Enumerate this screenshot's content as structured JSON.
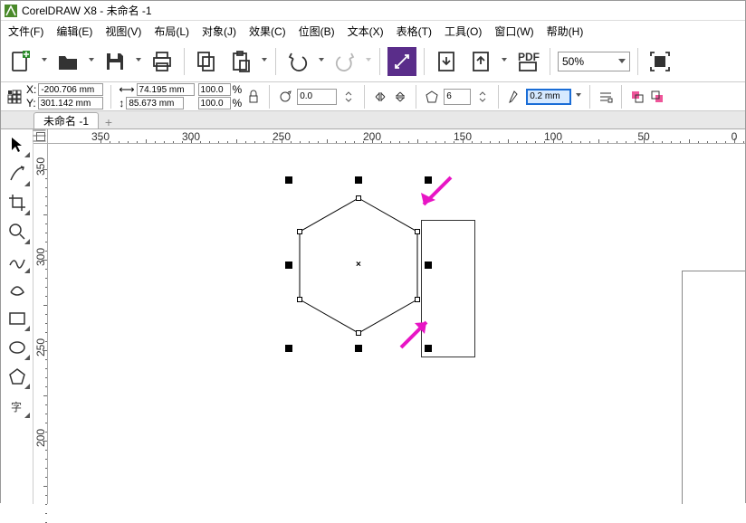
{
  "title": "CorelDRAW X8 - 未命名 -1",
  "menu": [
    "文件(F)",
    "编辑(E)",
    "视图(V)",
    "布局(L)",
    "对象(J)",
    "效果(C)",
    "位图(B)",
    "文本(X)",
    "表格(T)",
    "工具(O)",
    "窗口(W)",
    "帮助(H)"
  ],
  "zoom": "50%",
  "tab_name": "未命名 -1",
  "props": {
    "x": "-200.706 mm",
    "y": "301.142 mm",
    "w": "74.195 mm",
    "h": "85.673 mm",
    "sx": "100.0",
    "sy": "100.0",
    "pct": "%",
    "rot": "0.0",
    "sides": "6",
    "outline": "0.2 mm"
  },
  "ruler_h": [
    {
      "v": "350",
      "p": 58
    },
    {
      "v": "300",
      "p": 158
    },
    {
      "v": "250",
      "p": 258
    },
    {
      "v": "200",
      "p": 358
    },
    {
      "v": "150",
      "p": 458
    },
    {
      "v": "100",
      "p": 558
    },
    {
      "v": "50",
      "p": 658
    },
    {
      "v": "0",
      "p": 758
    }
  ],
  "ruler_v": [
    {
      "v": "350",
      "p": 28
    },
    {
      "v": "300",
      "p": 128
    },
    {
      "v": "250",
      "p": 228
    },
    {
      "v": "200",
      "p": 328
    }
  ]
}
